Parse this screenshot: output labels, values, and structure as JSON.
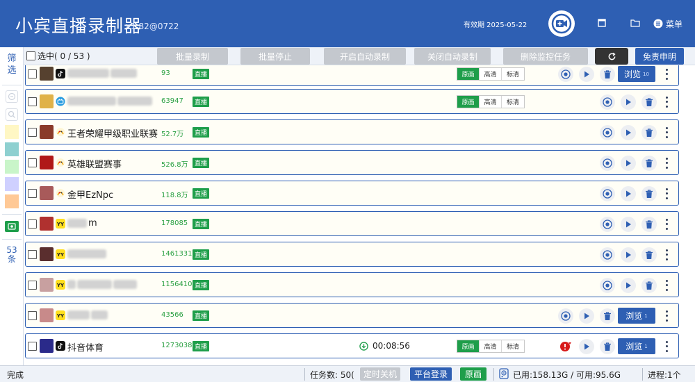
{
  "app": {
    "title": "小宾直播录制器",
    "version": "v1.82@0722",
    "expiry_label": "有效期 2025-05-22",
    "menu_label": "菜单"
  },
  "sidebar": {
    "filter_label": "筛选",
    "count_label": "53条",
    "swatch_colors": [
      "#fff7c4",
      "#8ed0d0",
      "#c9f5c9",
      "#cfd0ff",
      "#ffc996"
    ]
  },
  "toolbar": {
    "select_label": "选中( 0  /  53 )",
    "buttons": [
      "批量录制",
      "批量停止",
      "开启自动录制",
      "关闭自动录制",
      "删除监控任务"
    ],
    "disclaimer_label": "免责申明"
  },
  "quality_options": [
    "原画",
    "高清",
    "标清"
  ],
  "live_label": "直播",
  "browse_label": "浏览",
  "rows": [
    {
      "name_visible": "",
      "viewers": "93",
      "platform": "douyin",
      "thumb": "#56412f",
      "bg": "#fffef6",
      "quality": true,
      "browse": true,
      "browse_count": "10",
      "recording": false,
      "time": ""
    },
    {
      "name_visible": "",
      "viewers": "63947",
      "platform": "bili",
      "thumb": "#e0b248",
      "bg": "#fffef6",
      "quality": true,
      "browse": false,
      "browse_count": "",
      "recording": false,
      "time": ""
    },
    {
      "name_visible": "王者荣耀甲级职业联赛",
      "viewers": "52.7万",
      "platform": "huya",
      "thumb": "#8a3a2a",
      "bg": "#fffef6",
      "quality": false,
      "browse": false,
      "browse_count": "",
      "recording": false,
      "time": ""
    },
    {
      "name_visible": "英雄联盟赛事",
      "viewers": "526.8万",
      "platform": "huya",
      "thumb": "#b01818",
      "bg": "#fffef6",
      "quality": false,
      "browse": false,
      "browse_count": "",
      "recording": false,
      "time": ""
    },
    {
      "name_visible": "金甲EzNpc",
      "viewers": "118.8万",
      "platform": "huya",
      "thumb": "#a85a5a",
      "bg": "#fffef6",
      "quality": false,
      "browse": false,
      "browse_count": "",
      "recording": false,
      "time": ""
    },
    {
      "name_visible": "m",
      "viewers": "178085",
      "platform": "yy",
      "thumb": "#b0312f",
      "bg": "#fffef6",
      "quality": false,
      "browse": false,
      "browse_count": "",
      "recording": false,
      "time": ""
    },
    {
      "name_visible": "",
      "viewers": "1461331",
      "platform": "yy",
      "thumb": "#5a2e2e",
      "bg": "#fffef6",
      "quality": false,
      "browse": false,
      "browse_count": "",
      "recording": false,
      "time": ""
    },
    {
      "name_visible": "",
      "viewers": "1156410",
      "platform": "yy",
      "thumb": "#c8a0a0",
      "bg": "#fffef6",
      "quality": false,
      "browse": false,
      "browse_count": "",
      "recording": false,
      "time": ""
    },
    {
      "name_visible": "",
      "viewers": "43566",
      "platform": "yy",
      "thumb": "#c88a8a",
      "bg": "#fffef6",
      "quality": false,
      "browse": true,
      "browse_count": "1",
      "recording": false,
      "time": ""
    },
    {
      "name_visible": "抖音体育",
      "viewers": "1273038",
      "platform": "douyin",
      "thumb": "#2a2a8a",
      "bg": "#ffffff",
      "quality": true,
      "browse": true,
      "browse_count": "1",
      "recording": true,
      "time": "00:08:56"
    }
  ],
  "status": {
    "state": "完成",
    "task_count": "任务数: 50(",
    "timer_btn": "定时关机",
    "login_btn": "平台登录",
    "quality_btn": "原画",
    "disk": "已用:158.13G / 可用:95.6G",
    "process": "进程:1个"
  }
}
